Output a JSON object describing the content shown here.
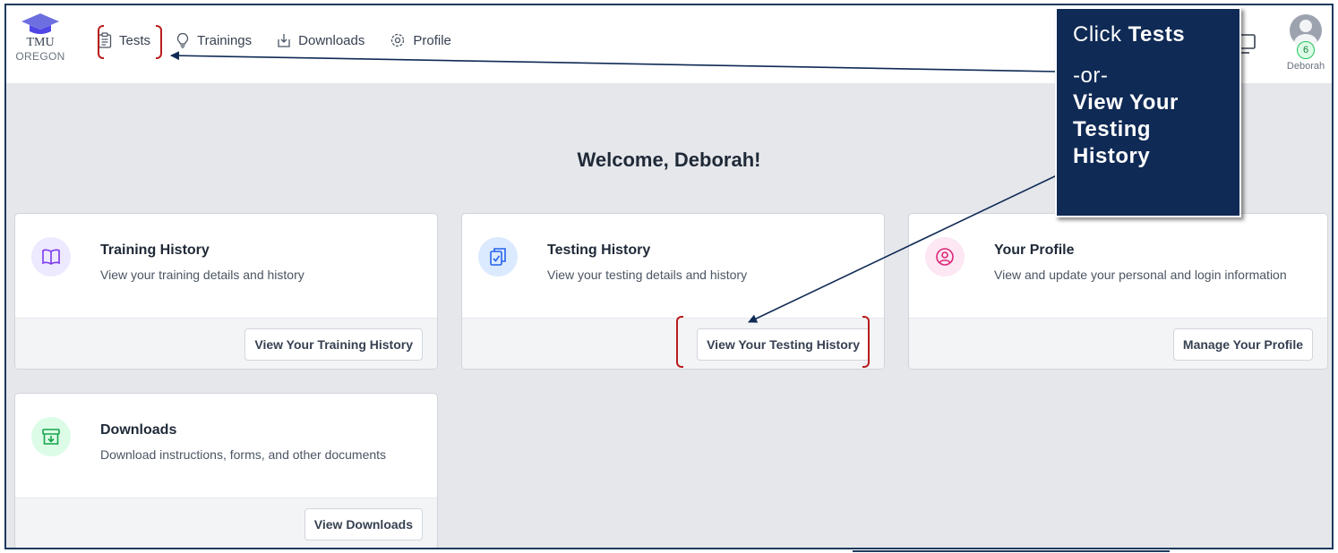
{
  "header": {
    "logo": {
      "brand": "TMU",
      "state": "OREGON"
    },
    "nav": [
      {
        "label": "Tests",
        "icon": "clipboard-icon"
      },
      {
        "label": "Trainings",
        "icon": "lightbulb-icon"
      },
      {
        "label": "Downloads",
        "icon": "download-tray-icon"
      },
      {
        "label": "Profile",
        "icon": "gear-icon"
      }
    ],
    "user": {
      "name": "Deborah",
      "badge_count": "6"
    }
  },
  "welcome": "Welcome, Deborah!",
  "cards": [
    {
      "title": "Training History",
      "desc": "View your training details and history",
      "button": "View Your Training History",
      "icon": "book-icon",
      "icon_bg": "#ede9fe",
      "icon_color": "#7c3aed"
    },
    {
      "title": "Testing History",
      "desc": "View your testing details and history",
      "button": "View Your Testing History",
      "icon": "clipboard-check-icon",
      "icon_bg": "#dbeafe",
      "icon_color": "#2563eb"
    },
    {
      "title": "Your Profile",
      "desc": "View and update your personal and login information",
      "button": "Manage Your Profile",
      "icon": "user-circle-icon",
      "icon_bg": "#fce7f3",
      "icon_color": "#db2777"
    },
    {
      "title": "Downloads",
      "desc": "Download instructions, forms, and other documents",
      "button": "View Downloads",
      "icon": "archive-download-icon",
      "icon_bg": "#dcfce7",
      "icon_color": "#16a34a"
    }
  ],
  "callout": {
    "line1_prefix": "Click ",
    "line1_bold": "Tests",
    "line2": "-or-",
    "line3": "View Your",
    "line4": "Testing",
    "line5": "History"
  },
  "colors": {
    "frame": "#1e3a5f",
    "callout_bg": "#0f2a55",
    "bracket": "#b91c1c",
    "page_bg": "#e5e7eb"
  }
}
